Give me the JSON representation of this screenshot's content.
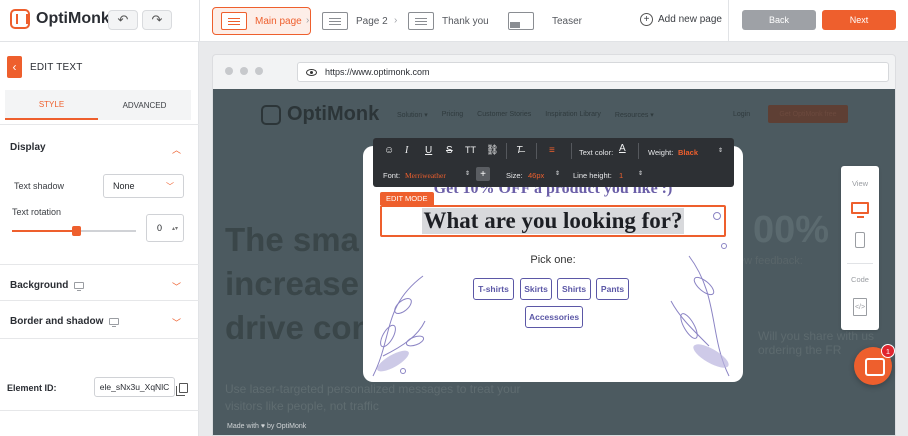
{
  "app": {
    "name": "OptiMonk"
  },
  "header": {
    "pages": [
      {
        "label": "Main page",
        "active": true
      },
      {
        "label": "Page 2",
        "active": false
      },
      {
        "label": "Thank you",
        "active": false
      },
      {
        "label": "Teaser",
        "active": false
      }
    ],
    "add_page_label": "Add new page",
    "back_label": "Back",
    "next_label": "Next",
    "undo_icon": "undo-icon",
    "redo_icon": "redo-icon"
  },
  "sidebar": {
    "title": "EDIT TEXT",
    "tabs": [
      {
        "label": "STYLE",
        "active": true
      },
      {
        "label": "ADVANCED",
        "active": false
      }
    ],
    "sections": {
      "display": "Display",
      "background": "Background",
      "border": "Border and shadow"
    },
    "text_shadow_label": "Text shadow",
    "text_shadow_value": "None",
    "text_rotation_label": "Text rotation",
    "text_rotation_value": "0",
    "text_rotation_level_percent": 52,
    "element_id_label": "Element ID:",
    "element_id_value": "ele_sNx3u_XqNlC"
  },
  "browser": {
    "url": "https://www.optimonk.com"
  },
  "site": {
    "logo": "OptiMonk",
    "nav": [
      "Solution ▾",
      "Pricing",
      "Customer Stories",
      "Inspiration Library",
      "Resources ▾"
    ],
    "login": "Login",
    "cta": "Get OptiMonk free",
    "hero_lines": [
      "The sma",
      "increase",
      "drive con"
    ],
    "hero_sub": "Use laser-targeted personalized messages to treat your visitors like people, not traffic",
    "right_a": "00%",
    "right_b": "ew feedback:",
    "right_c": "Will you share with us ordering the FR",
    "made_with": "Made with ♥ by OptiMonk"
  },
  "popup": {
    "partial_headline": "Get 10% OFF a product you like :)",
    "edit_mode": "EDIT MODE",
    "headline": "What are you looking for?",
    "pick_one": "Pick one:",
    "choices": [
      "T-shirts",
      "Skirts",
      "Shirts",
      "Pants",
      "Accessories"
    ]
  },
  "toolbar": {
    "text_color_label": "Text color:",
    "weight_label": "Weight:",
    "weight_value": "Black",
    "font_label": "Font:",
    "font_value": "Merriweather",
    "size_label": "Size:",
    "size_value": "46px",
    "line_height_label": "Line height:",
    "line_height_value": "1"
  },
  "device_panel": {
    "view_label": "View",
    "code_label": "Code",
    "code_glyph": "</>"
  },
  "chat": {
    "badge_count": "1"
  },
  "colors": {
    "accent": "#ee5f2d",
    "popup_purple": "#5b57a6",
    "toolbar_bg": "#2d3034",
    "site_overlay": "#4c5a60"
  }
}
